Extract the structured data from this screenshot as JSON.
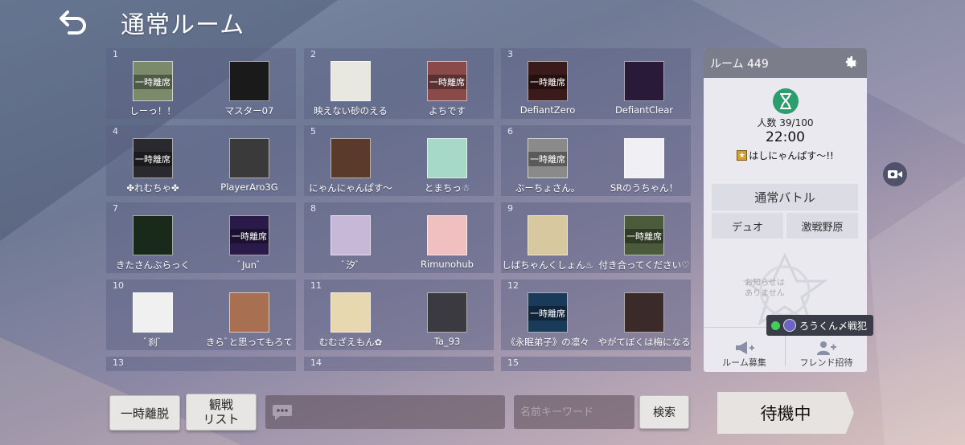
{
  "header": {
    "title": "通常ルーム",
    "back_icon": "back-arrow-icon"
  },
  "away_label": "一時離席",
  "rooms": [
    {
      "num": "1",
      "members": [
        {
          "name": "しーっ！！",
          "avatar": "#7a8a6a",
          "away": true
        },
        {
          "name": "マスター07",
          "avatar": "#1a1a1a",
          "away": false
        }
      ]
    },
    {
      "num": "2",
      "members": [
        {
          "name": "映えない砂のえる",
          "avatar": "#e8e8e0",
          "away": false
        },
        {
          "name": "よちです",
          "avatar": "#8a4a4a",
          "away": true
        }
      ]
    },
    {
      "num": "3",
      "members": [
        {
          "name": "DefiantZero",
          "avatar": "#3a1a1a",
          "away": true
        },
        {
          "name": "DefiantClear",
          "avatar": "#2a1a3a",
          "away": false
        }
      ]
    },
    {
      "num": "4",
      "members": [
        {
          "name": "✤れむちゃ✤",
          "avatar": "#2a2a2e",
          "away": true
        },
        {
          "name": "PlayerAro3G",
          "avatar": "#3a3a3a",
          "away": false
        }
      ]
    },
    {
      "num": "5",
      "members": [
        {
          "name": "にゃんにゃんぱす〜",
          "avatar": "#5a3a2a",
          "away": false
        },
        {
          "name": "とまちっ☃",
          "avatar": "#a8d8c8",
          "away": false
        }
      ]
    },
    {
      "num": "6",
      "members": [
        {
          "name": "ぶーちょさん。",
          "avatar": "#8a8a8a",
          "away": true
        },
        {
          "name": "SRのうちゃん！",
          "avatar": "#f0f0f4",
          "away": false
        }
      ]
    },
    {
      "num": "7",
      "members": [
        {
          "name": "きたさんぶらっく",
          "avatar": "#1a2a1a",
          "away": false
        },
        {
          "name": "ﾞJunﾞ",
          "avatar": "#2a1a4a",
          "away": true
        }
      ]
    },
    {
      "num": "8",
      "members": [
        {
          "name": "ﾞ汐ﾞ",
          "avatar": "#c8b8d8",
          "away": false
        },
        {
          "name": "Rimunohub",
          "avatar": "#f0c0c0",
          "away": false
        }
      ]
    },
    {
      "num": "9",
      "members": [
        {
          "name": "しばちゃんくしょん♨",
          "avatar": "#d8c8a0",
          "away": false
        },
        {
          "name": "付き合ってください♡",
          "avatar": "#4a5a3a",
          "away": true
        }
      ]
    },
    {
      "num": "10",
      "members": [
        {
          "name": "ﾞ刹ﾞ",
          "avatar": "#f0f0f0",
          "away": false
        },
        {
          "name": "きらﾞと思ってもろて",
          "avatar": "#a87050",
          "away": false
        }
      ]
    },
    {
      "num": "11",
      "members": [
        {
          "name": "むむざえもん✿",
          "avatar": "#e8d8b0",
          "away": false
        },
        {
          "name": "Ta_93",
          "avatar": "#3a3a40",
          "away": false
        }
      ]
    },
    {
      "num": "12",
      "members": [
        {
          "name": "《永眠弟子》の凛々",
          "avatar": "#1a3a5a",
          "away": true
        },
        {
          "name": "やがてぼくは梅になる",
          "avatar": "#3a2a2a",
          "away": false
        }
      ]
    },
    {
      "num": "13",
      "members": []
    },
    {
      "num": "14",
      "members": []
    },
    {
      "num": "15",
      "members": []
    }
  ],
  "panel": {
    "room_label": "ルーム 449",
    "count": "人数 39/100",
    "time": "22:00",
    "host": "はしにゃんぱす〜!!",
    "mode": "通常バトル",
    "sub1": "デュオ",
    "sub2": "激戦野原",
    "notice_line1": "お知らせは",
    "notice_line2": "ありません",
    "recruit": "ルーム募集",
    "invite": "フレンド招待",
    "accent": "#2e9d6d"
  },
  "online_tag": {
    "name": "ろうくん〆戦犯",
    "dot_color": "#3fcf5a"
  },
  "bottom": {
    "leave": "一時離脱",
    "watch_line1": "観戦",
    "watch_line2": "リスト",
    "search_placeholder": "名前キーワード",
    "search": "検索",
    "standby": "待機中"
  }
}
